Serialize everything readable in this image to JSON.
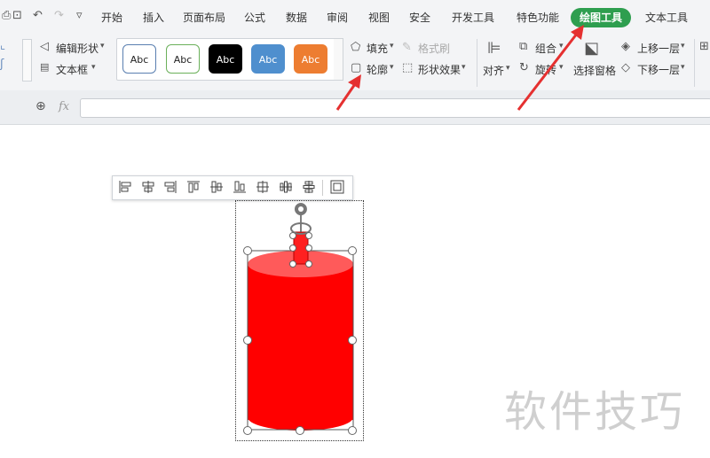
{
  "menu": {
    "tabs": [
      "开始",
      "插入",
      "页面布局",
      "公式",
      "数据",
      "审阅",
      "视图",
      "安全",
      "开发工具",
      "特色功能",
      "绘图工具",
      "文本工具"
    ],
    "active": "绘图工具"
  },
  "ribbon": {
    "edit_shape": "编辑形状",
    "text_box": "文本框",
    "style_swatches": [
      {
        "label": "Abc",
        "bg": "#ffffff",
        "fg": "#222222",
        "border": "#5a7fb0"
      },
      {
        "label": "Abc",
        "bg": "#ffffff",
        "fg": "#222222",
        "border": "#6bb05a"
      },
      {
        "label": "Abc",
        "bg": "#000000",
        "fg": "#ffffff",
        "border": "#000000"
      },
      {
        "label": "Abc",
        "bg": "#4f8fce",
        "fg": "#ffffff",
        "border": "#4f8fce"
      },
      {
        "label": "Abc",
        "bg": "#ed7d31",
        "fg": "#ffffff",
        "border": "#ed7d31"
      }
    ],
    "fill": "填充",
    "format_painter": "格式刷",
    "outline": "轮廓",
    "shape_effects": "形状效果",
    "align": "对齐",
    "group": "组合",
    "rotate": "旋转",
    "selection_pane": "选择窗格",
    "bring_forward": "上移一层",
    "send_backward": "下移一层"
  },
  "formula": {
    "fx": "fx",
    "value": ""
  },
  "shape": {
    "fill_color": "#ff0000",
    "top_color": "#ff5a5a"
  },
  "colors": {
    "accent": "#2e9e4f",
    "arrow": "#e53030"
  },
  "watermark": "软件技巧"
}
